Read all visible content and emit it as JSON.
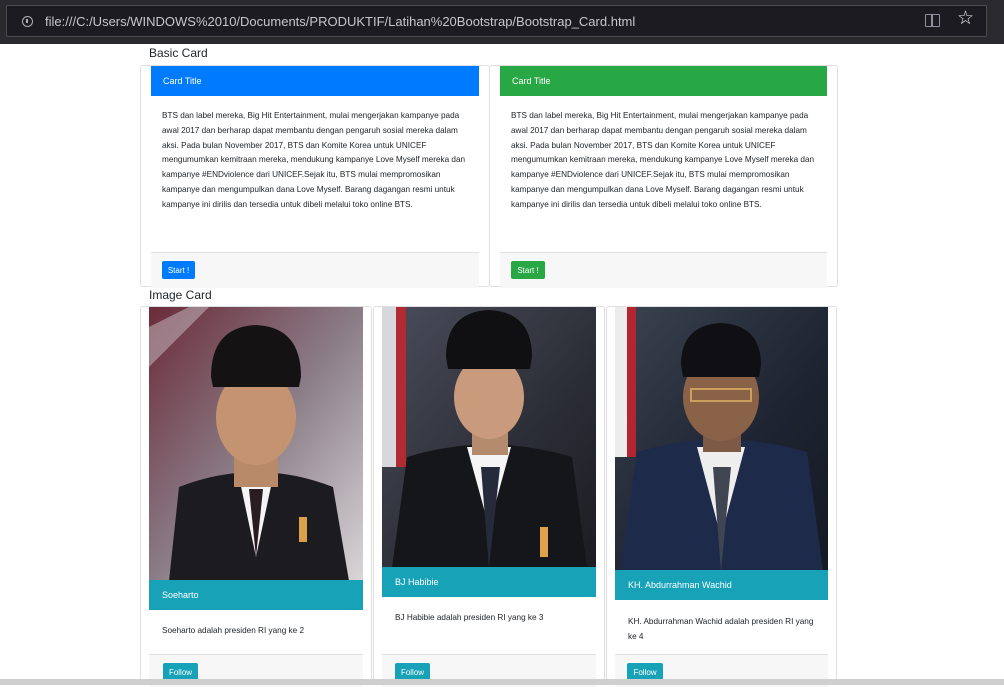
{
  "browser": {
    "url": "file:///C:/Users/WINDOWS%2010/Documents/PRODUKTIF/Latihan%20Bootstrap/Bootstrap_Card.html"
  },
  "sections": {
    "basic_title": "Basic Card",
    "image_title": "Image Card"
  },
  "basic_cards": [
    {
      "header": "Card Title",
      "text": "BTS dan label mereka, Big Hit Entertainment, mulai mengerjakan kampanye pada awal 2017 dan berharap dapat membantu dengan pengaruh sosial mereka dalam aksi. Pada bulan November 2017, BTS dan Komite Korea untuk UNICEF mengumumkan kemitraan mereka, mendukung kampanye Love Myself mereka dan kampanye #ENDviolence dari UNICEF.Sejak itu, BTS mulai mempromosikan kampanye dan mengumpulkan dana Love Myself. Barang dagangan resmi untuk kampanye ini dirilis dan tersedia untuk dibeli melalui toko online BTS.",
      "button": "Start !",
      "color": "#007bff"
    },
    {
      "header": "Card Title",
      "text": "BTS dan label mereka, Big Hit Entertainment, mulai mengerjakan kampanye pada awal 2017 dan berharap dapat membantu dengan pengaruh sosial mereka dalam aksi. Pada bulan November 2017, BTS dan Komite Korea untuk UNICEF mengumumkan kemitraan mereka, mendukung kampanye Love Myself mereka dan kampanye #ENDviolence dari UNICEF.Sejak itu, BTS mulai mempromosikan kampanye dan mengumpulkan dana Love Myself. Barang dagangan resmi untuk kampanye ini dirilis dan tersedia untuk dibeli melalui toko online BTS.",
      "button": "Start !",
      "color": "#28a745"
    }
  ],
  "image_cards": [
    {
      "name": "Soeharto",
      "text": "Soeharto adalah presiden RI yang ke 2",
      "button": "Follow"
    },
    {
      "name": "BJ Habibie",
      "text": "BJ Habibie adalah presiden RI yang ke 3",
      "button": "Follow"
    },
    {
      "name": "KH. Abdurrahman Wachid",
      "text": "KH. Abdurrahman Wachid adalah presiden RI yang ke 4",
      "button": "Follow"
    }
  ],
  "colors": {
    "primary": "#007bff",
    "success": "#28a745",
    "info": "#17a2b8"
  },
  "icons": [
    "info-icon",
    "reader-view-icon",
    "bookmark-star-icon"
  ]
}
